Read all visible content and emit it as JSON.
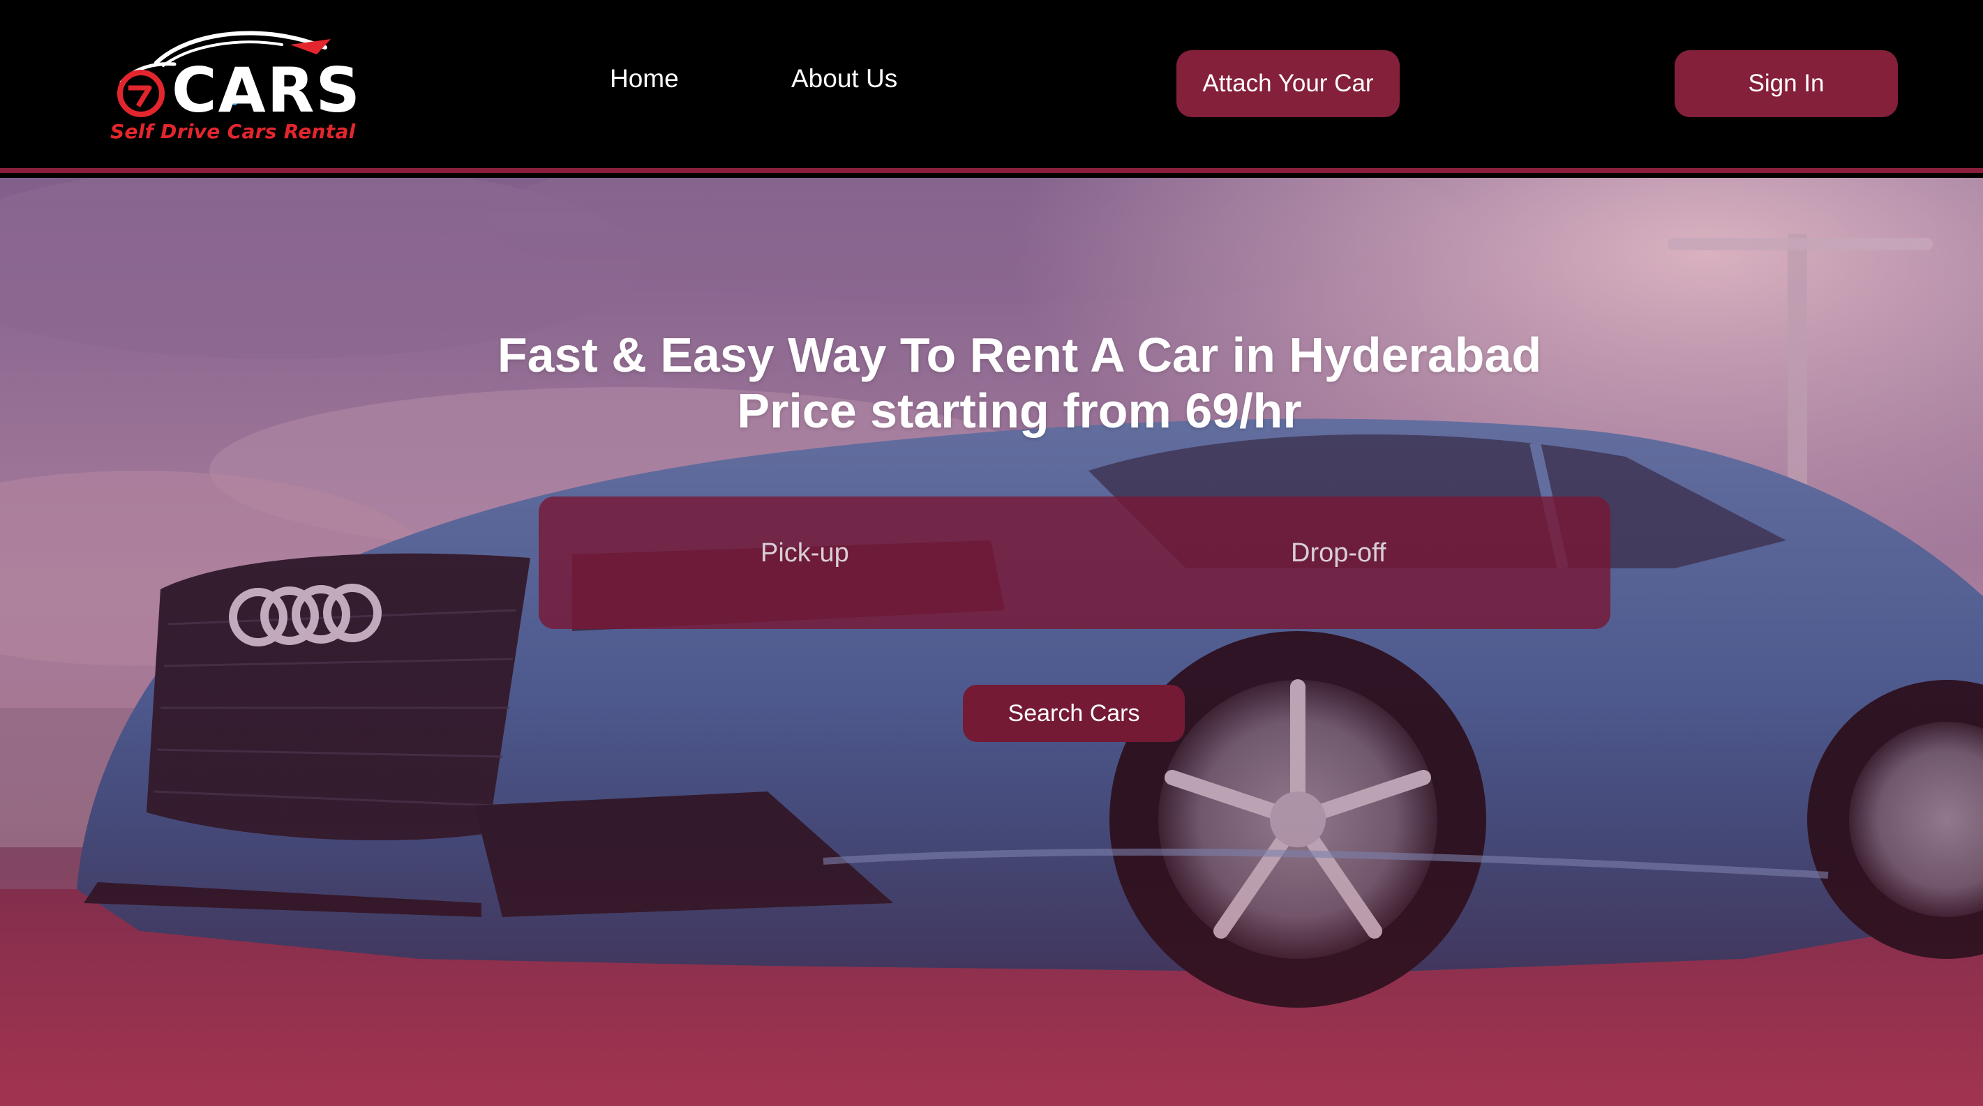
{
  "brand": {
    "logo_word": "CARS",
    "logo_mark": "G7",
    "tagline": "Self Drive Cars Rental",
    "accent_color": "#e3262e"
  },
  "nav": {
    "links": [
      {
        "label": "Home"
      },
      {
        "label": "About Us"
      }
    ],
    "attach_label": "Attach Your Car",
    "signin_label": "Sign In",
    "button_color": "#84203a"
  },
  "hero": {
    "headline_line1": "Fast & Easy Way To Rent A Car in Hyderabad",
    "headline_line2": "Price starting from 69/hr",
    "background": "blue-sedan-photo",
    "search": {
      "pickup_label": "Pick-up",
      "dropoff_label": "Drop-off",
      "button_label": "Search Cars"
    }
  }
}
